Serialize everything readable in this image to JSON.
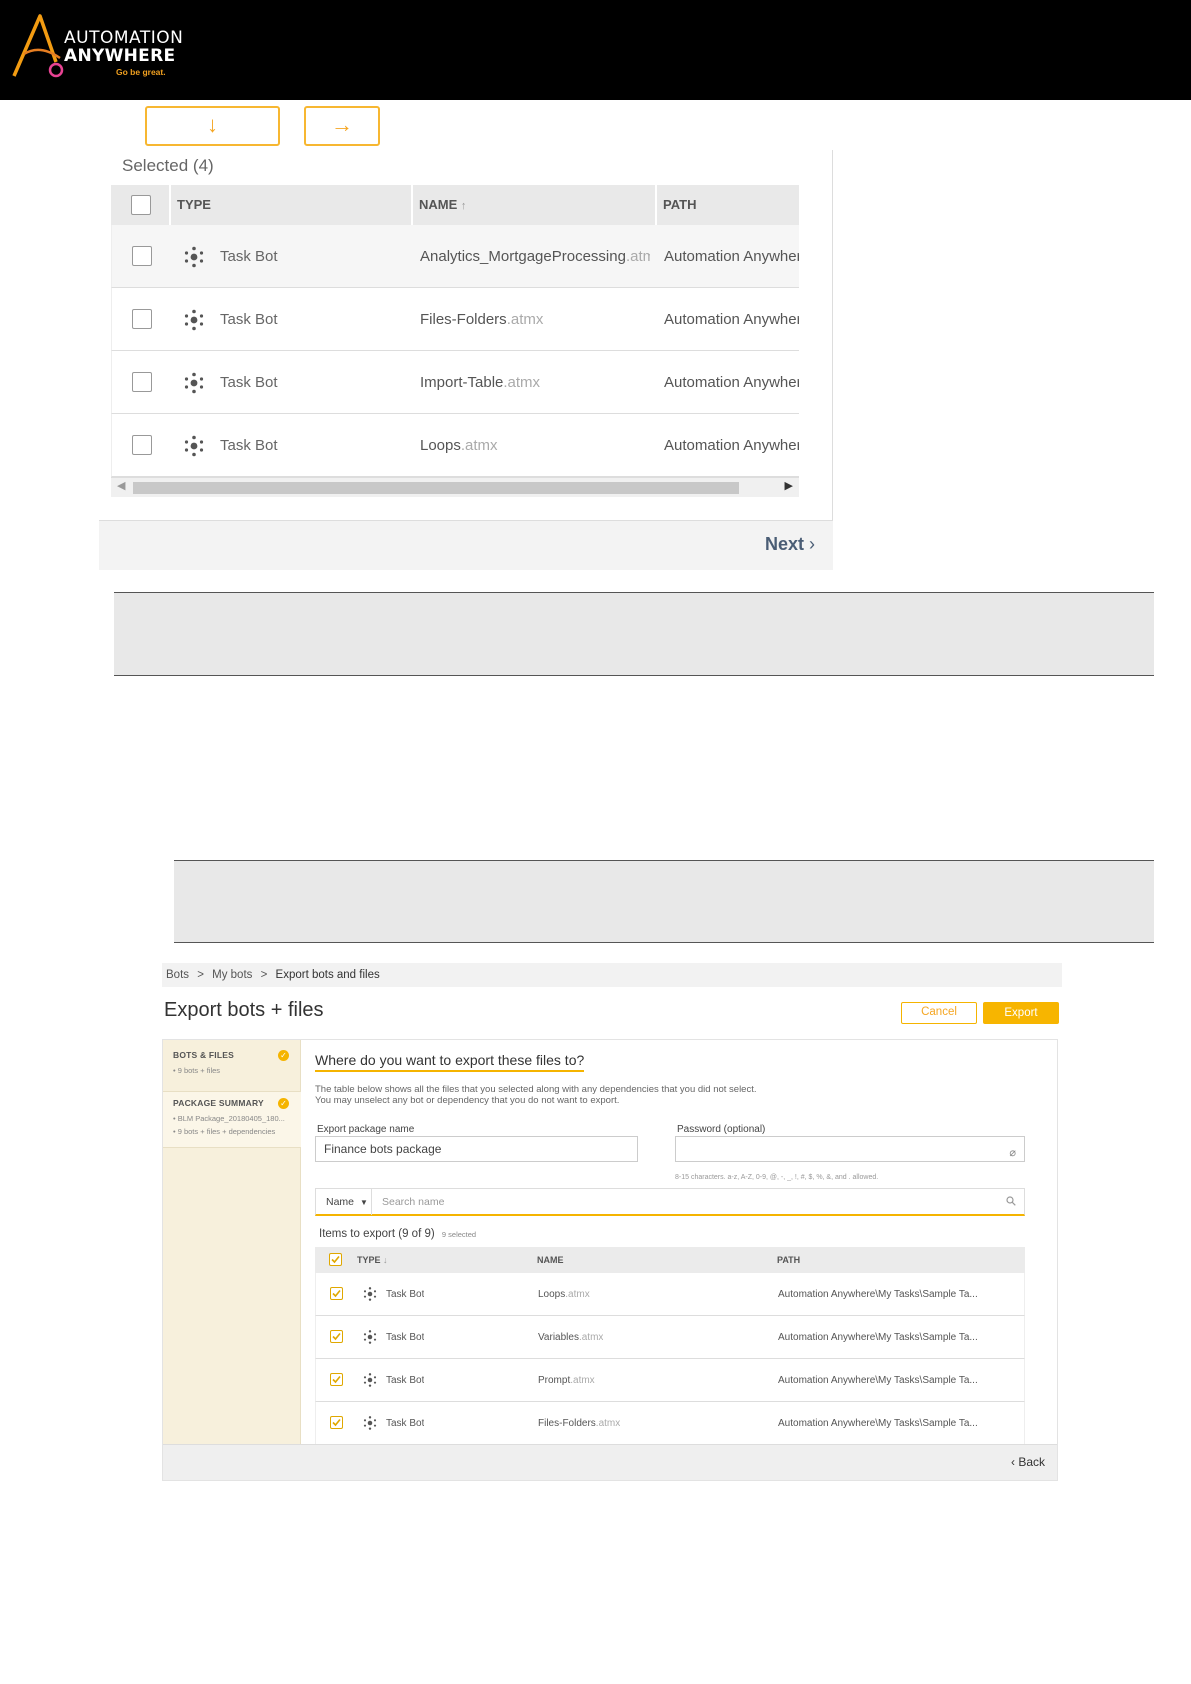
{
  "brand": {
    "line1": "AUTOMATION",
    "line2": "ANYWHERE",
    "tagline": "Go be great.",
    "accent_color": "#f7b500"
  },
  "top_section": {
    "arrow_down_label": "↓",
    "arrow_right_label": "→",
    "selected_title": "Selected",
    "selected_count": "(4)",
    "columns": {
      "type": "TYPE",
      "name": "NAME",
      "name_sort": "↑",
      "path": "PATH"
    },
    "rows": [
      {
        "type": "Task Bot",
        "name": "Analytics_MortgageProcessing",
        "ext": ".atmx",
        "path": "Automation Anywhere"
      },
      {
        "type": "Task Bot",
        "name": "Files-Folders",
        "ext": ".atmx",
        "path": "Automation Anywhere"
      },
      {
        "type": "Task Bot",
        "name": "Import-Table",
        "ext": ".atmx",
        "path": "Automation Anywhere"
      },
      {
        "type": "Task Bot",
        "name": "Loops",
        "ext": ".atmx",
        "path": "Automation Anywhere"
      }
    ],
    "next_label": "Next",
    "next_icon": "›"
  },
  "export_screen": {
    "breadcrumb": {
      "item1": "Bots",
      "sep": ">",
      "item2": "My bots",
      "item3": "Export bots and files"
    },
    "title": "Export bots + files",
    "cancel_label": "Cancel",
    "export_label": "Export",
    "sidebar": [
      {
        "title": "BOTS & FILES",
        "sub": "• 9 bots + files"
      },
      {
        "title": "PACKAGE SUMMARY",
        "sub": "• BLM Package_20180405_180...",
        "sub2": "• 9 bots + files + dependencies"
      }
    ],
    "question": "Where do you want to export these files to?",
    "desc_line1": "The table below shows all the files that you selected along with any dependencies that you did not select.",
    "desc_line2": "You may unselect any bot or dependency that you do not want to export.",
    "package_name_label": "Export package name",
    "package_name_value": "Finance bots package",
    "password_label": "Password (optional)",
    "password_hint": "8-15 characters. a-z, A-Z, 0-9, @, -, _, !, #, $, %, &, and . allowed.",
    "search_field": "Name",
    "search_placeholder": "Search name",
    "items_label": "Items to export",
    "items_count": "(9 of 9)",
    "items_selected": "9 selected",
    "columns": {
      "type": "TYPE",
      "type_sort": "↓",
      "name": "NAME",
      "path": "PATH"
    },
    "rows": [
      {
        "type": "Task Bot",
        "name": "Loops",
        "ext": ".atmx",
        "path": "Automation Anywhere\\My Tasks\\Sample Ta..."
      },
      {
        "type": "Task Bot",
        "name": "Variables",
        "ext": ".atmx",
        "path": "Automation Anywhere\\My Tasks\\Sample Ta..."
      },
      {
        "type": "Task Bot",
        "name": "Prompt",
        "ext": ".atmx",
        "path": "Automation Anywhere\\My Tasks\\Sample Ta..."
      },
      {
        "type": "Task Bot",
        "name": "Files-Folders",
        "ext": ".atmx",
        "path": "Automation Anywhere\\My Tasks\\Sample Ta..."
      }
    ],
    "back_icon": "‹",
    "back_label": "Back"
  }
}
